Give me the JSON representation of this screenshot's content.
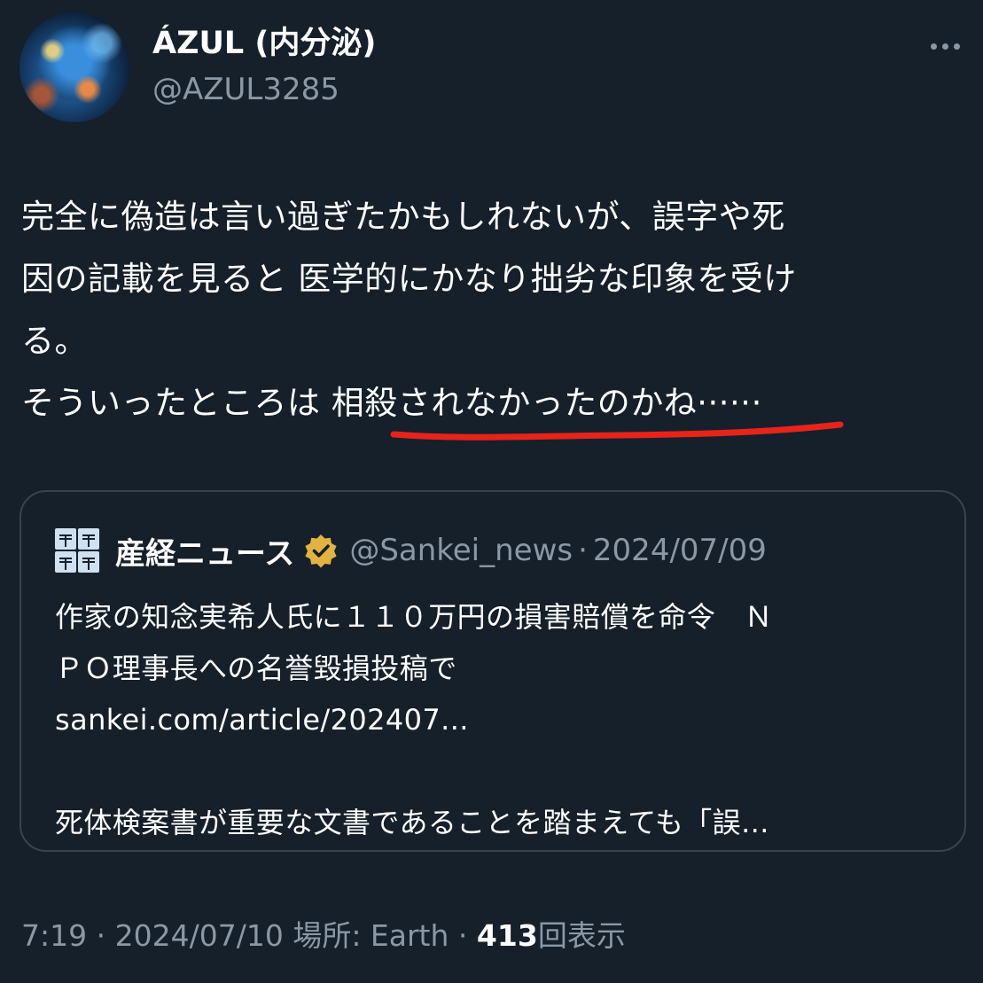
{
  "author": {
    "display_name": "ÁZUL (内分泌)",
    "handle": "@AZUL3285"
  },
  "tweet": {
    "lines": [
      "完全に偽造は言い過ぎたかもしれないが、誤字や死",
      "因の記載を見ると 医学的にかなり拙劣な印象を受け",
      "る。",
      "そういったところは 相殺されなかったのかね······"
    ]
  },
  "quote": {
    "name": "産経ニュース",
    "handle": "@Sankei_news",
    "separator": "·",
    "date": "2024/07/09",
    "lines": [
      "作家の知念実希人氏に１１０万円の損害賠償を命令　Ｎ",
      "ＰＯ理事長への名誉毀損投稿で",
      "sankei.com/article/202407...",
      "",
      "死体検案書が重要な文書であることを踏まえても「誤..."
    ]
  },
  "meta": {
    "time": "7:19",
    "sep1": "·",
    "date": "2024/07/10",
    "location": "場所: Earth",
    "sep2": "·",
    "views": "413",
    "views_label": "回表示"
  },
  "icons": {
    "more": "more-dots-icon",
    "verified": "verified-badge-icon",
    "quote_avatar": "sankei-logo-icon",
    "annotation": "red-underline-annotation"
  },
  "colors": {
    "background": "#15202b",
    "secondary_text": "#8b98a5",
    "border": "#38444d",
    "underline": "#e8231a",
    "verified_gold": "#e3b341"
  }
}
